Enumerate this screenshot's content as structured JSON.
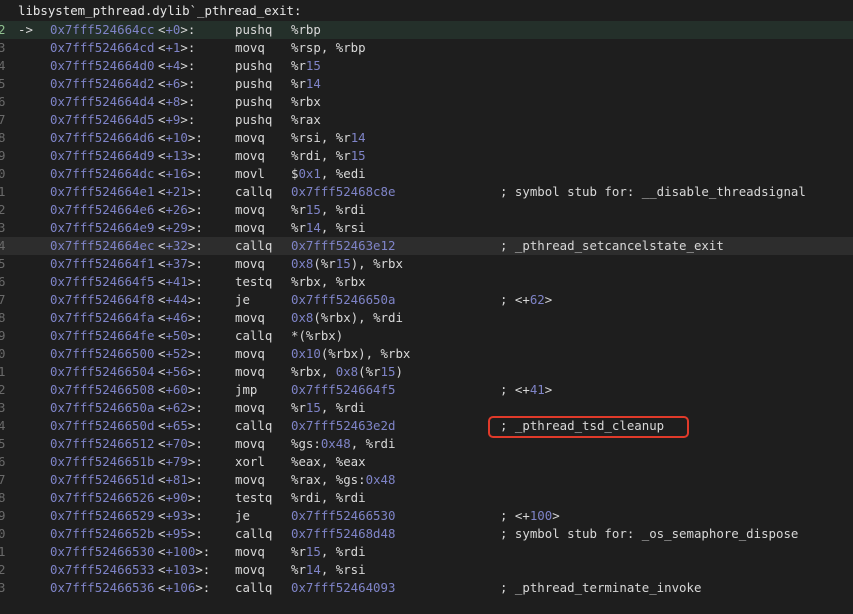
{
  "header": {
    "title": "libsystem_pthread.dylib`_pthread_exit:"
  },
  "colors": {
    "background": "#1e1e1e",
    "address": "#7f84c8",
    "highlight_box": "#e03a2a"
  },
  "rows": [
    {
      "gutter": "2",
      "arrow": "->",
      "address": "0x7fff524664cc",
      "offset": "+0",
      "mnemonic": "pushq",
      "operands": "%rbp",
      "comment": ""
    },
    {
      "gutter": "3",
      "arrow": "",
      "address": "0x7fff524664cd",
      "offset": "+1",
      "mnemonic": "movq",
      "operands": "%rsp, %rbp",
      "comment": ""
    },
    {
      "gutter": "4",
      "arrow": "",
      "address": "0x7fff524664d0",
      "offset": "+4",
      "mnemonic": "pushq",
      "operands": "%r15",
      "comment": ""
    },
    {
      "gutter": "5",
      "arrow": "",
      "address": "0x7fff524664d2",
      "offset": "+6",
      "mnemonic": "pushq",
      "operands": "%r14",
      "comment": ""
    },
    {
      "gutter": "6",
      "arrow": "",
      "address": "0x7fff524664d4",
      "offset": "+8",
      "mnemonic": "pushq",
      "operands": "%rbx",
      "comment": ""
    },
    {
      "gutter": "7",
      "arrow": "",
      "address": "0x7fff524664d5",
      "offset": "+9",
      "mnemonic": "pushq",
      "operands": "%rax",
      "comment": ""
    },
    {
      "gutter": "8",
      "arrow": "",
      "address": "0x7fff524664d6",
      "offset": "+10",
      "mnemonic": "movq",
      "operands": "%rsi, %r14",
      "comment": ""
    },
    {
      "gutter": "9",
      "arrow": "",
      "address": "0x7fff524664d9",
      "offset": "+13",
      "mnemonic": "movq",
      "operands": "%rdi, %r15",
      "comment": ""
    },
    {
      "gutter": "0",
      "arrow": "",
      "address": "0x7fff524664dc",
      "offset": "+16",
      "mnemonic": "movl",
      "operands": "$0x1, %edi",
      "comment": ""
    },
    {
      "gutter": "1",
      "arrow": "",
      "address": "0x7fff524664e1",
      "offset": "+21",
      "mnemonic": "callq",
      "operands": "0x7fff52468c8e",
      "comment": "; symbol stub for: __disable_threadsignal"
    },
    {
      "gutter": "2",
      "arrow": "",
      "address": "0x7fff524664e6",
      "offset": "+26",
      "mnemonic": "movq",
      "operands": "%r15, %rdi",
      "comment": ""
    },
    {
      "gutter": "3",
      "arrow": "",
      "address": "0x7fff524664e9",
      "offset": "+29",
      "mnemonic": "movq",
      "operands": "%r14, %rsi",
      "comment": ""
    },
    {
      "gutter": "4",
      "arrow": "",
      "address": "0x7fff524664ec",
      "offset": "+32",
      "mnemonic": "callq",
      "operands": "0x7fff52463e12",
      "comment": "; _pthread_setcancelstate_exit"
    },
    {
      "gutter": "5",
      "arrow": "",
      "address": "0x7fff524664f1",
      "offset": "+37",
      "mnemonic": "movq",
      "operands": "0x8(%r15), %rbx",
      "comment": ""
    },
    {
      "gutter": "6",
      "arrow": "",
      "address": "0x7fff524664f5",
      "offset": "+41",
      "mnemonic": "testq",
      "operands": "%rbx, %rbx",
      "comment": ""
    },
    {
      "gutter": "7",
      "arrow": "",
      "address": "0x7fff524664f8",
      "offset": "+44",
      "mnemonic": "je",
      "operands": "0x7fff5246650a",
      "comment": "; <+62>"
    },
    {
      "gutter": "8",
      "arrow": "",
      "address": "0x7fff524664fa",
      "offset": "+46",
      "mnemonic": "movq",
      "operands": "0x8(%rbx), %rdi",
      "comment": ""
    },
    {
      "gutter": "9",
      "arrow": "",
      "address": "0x7fff524664fe",
      "offset": "+50",
      "mnemonic": "callq",
      "operands": "*(%rbx)",
      "comment": ""
    },
    {
      "gutter": "0",
      "arrow": "",
      "address": "0x7fff52466500",
      "offset": "+52",
      "mnemonic": "movq",
      "operands": "0x10(%rbx), %rbx",
      "comment": ""
    },
    {
      "gutter": "1",
      "arrow": "",
      "address": "0x7fff52466504",
      "offset": "+56",
      "mnemonic": "movq",
      "operands": "%rbx, 0x8(%r15)",
      "comment": ""
    },
    {
      "gutter": "2",
      "arrow": "",
      "address": "0x7fff52466508",
      "offset": "+60",
      "mnemonic": "jmp",
      "operands": "0x7fff524664f5",
      "comment": "; <+41>"
    },
    {
      "gutter": "3",
      "arrow": "",
      "address": "0x7fff5246650a",
      "offset": "+62",
      "mnemonic": "movq",
      "operands": "%r15, %rdi",
      "comment": ""
    },
    {
      "gutter": "4",
      "arrow": "",
      "address": "0x7fff5246650d",
      "offset": "+65",
      "mnemonic": "callq",
      "operands": "0x7fff52463e2d",
      "comment": "; _pthread_tsd_cleanup"
    },
    {
      "gutter": "5",
      "arrow": "",
      "address": "0x7fff52466512",
      "offset": "+70",
      "mnemonic": "movq",
      "operands": "%gs:0x48, %rdi",
      "comment": ""
    },
    {
      "gutter": "6",
      "arrow": "",
      "address": "0x7fff5246651b",
      "offset": "+79",
      "mnemonic": "xorl",
      "operands": "%eax, %eax",
      "comment": ""
    },
    {
      "gutter": "7",
      "arrow": "",
      "address": "0x7fff5246651d",
      "offset": "+81",
      "mnemonic": "movq",
      "operands": "%rax, %gs:0x48",
      "comment": ""
    },
    {
      "gutter": "8",
      "arrow": "",
      "address": "0x7fff52466526",
      "offset": "+90",
      "mnemonic": "testq",
      "operands": "%rdi, %rdi",
      "comment": ""
    },
    {
      "gutter": "9",
      "arrow": "",
      "address": "0x7fff52466529",
      "offset": "+93",
      "mnemonic": "je",
      "operands": "0x7fff52466530",
      "comment": "; <+100>"
    },
    {
      "gutter": "0",
      "arrow": "",
      "address": "0x7fff5246652b",
      "offset": "+95",
      "mnemonic": "callq",
      "operands": "0x7fff52468d48",
      "comment": "; symbol stub for: _os_semaphore_dispose"
    },
    {
      "gutter": "1",
      "arrow": "",
      "address": "0x7fff52466530",
      "offset": "+100",
      "mnemonic": "movq",
      "operands": "%r15, %rdi",
      "comment": ""
    },
    {
      "gutter": "2",
      "arrow": "",
      "address": "0x7fff52466533",
      "offset": "+103",
      "mnemonic": "movq",
      "operands": "%r14, %rsi",
      "comment": ""
    },
    {
      "gutter": "3",
      "arrow": "",
      "address": "0x7fff52466536",
      "offset": "+106",
      "mnemonic": "callq",
      "operands": "0x7fff52464093",
      "comment": "; _pthread_terminate_invoke"
    }
  ]
}
